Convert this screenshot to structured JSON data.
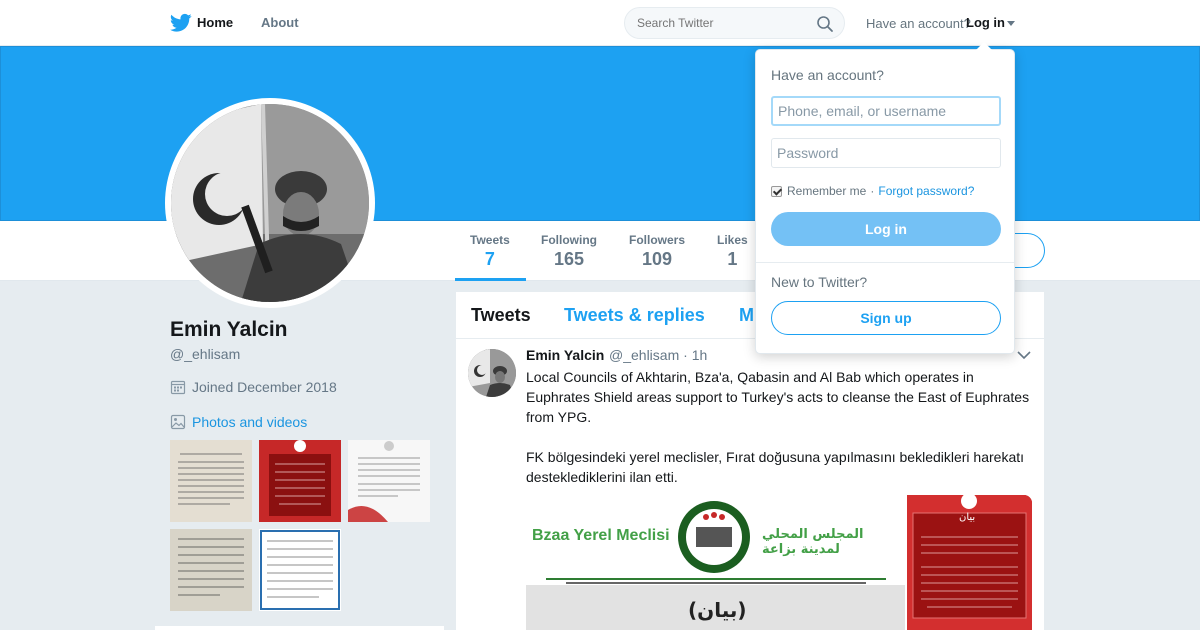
{
  "nav": {
    "home_label": "Home",
    "about_label": "About",
    "search_placeholder": "Search Twitter",
    "have_account": "Have an account?",
    "login_label": "Log in"
  },
  "profile": {
    "name": "Emin Yalcin",
    "handle": "@_ehlisam",
    "joined": "Joined December 2018",
    "photos_link": "Photos and videos"
  },
  "stats": [
    {
      "label": "Tweets",
      "value": "7"
    },
    {
      "label": "Following",
      "value": "165"
    },
    {
      "label": "Followers",
      "value": "109"
    },
    {
      "label": "Likes",
      "value": "1"
    }
  ],
  "timeline": {
    "tabs": [
      "Tweets",
      "Tweets & replies",
      "M"
    ],
    "tweet": {
      "name": "Emin Yalcin",
      "handle": "@_ehlisam",
      "sep": "·",
      "time": "1h",
      "text_en": "Local Councils of Akhtarin, Bza'a, Qabasin and Al Bab which operates in Euphrates Shield areas support to Turkey's acts to cleanse the East of Euphrates from YPG.",
      "text_tr": "FK bölgesindeki yerel meclisler, Fırat doğusuna yapılmasını bekledikleri harekatı desteklediklerini ilan etti.",
      "media_text_latin": "Bzaa Yerel Meclisi",
      "media_text_arabic": "المجلس المحلي لمدينة بزاعة",
      "media_text_statement": "(بيان)",
      "media_right_header": "بيان"
    }
  },
  "login_dropdown": {
    "title": "Have an account?",
    "username_placeholder": "Phone, email, or username",
    "password_placeholder": "Password",
    "remember": "Remember me",
    "dot": "·",
    "forgot": "Forgot password?",
    "login_button": "Log in",
    "new_to": "New to Twitter?",
    "signup_button": "Sign up"
  },
  "colors": {
    "brand": "#1da1f2",
    "link": "#1b95e0",
    "background": "#e6ecf0"
  }
}
